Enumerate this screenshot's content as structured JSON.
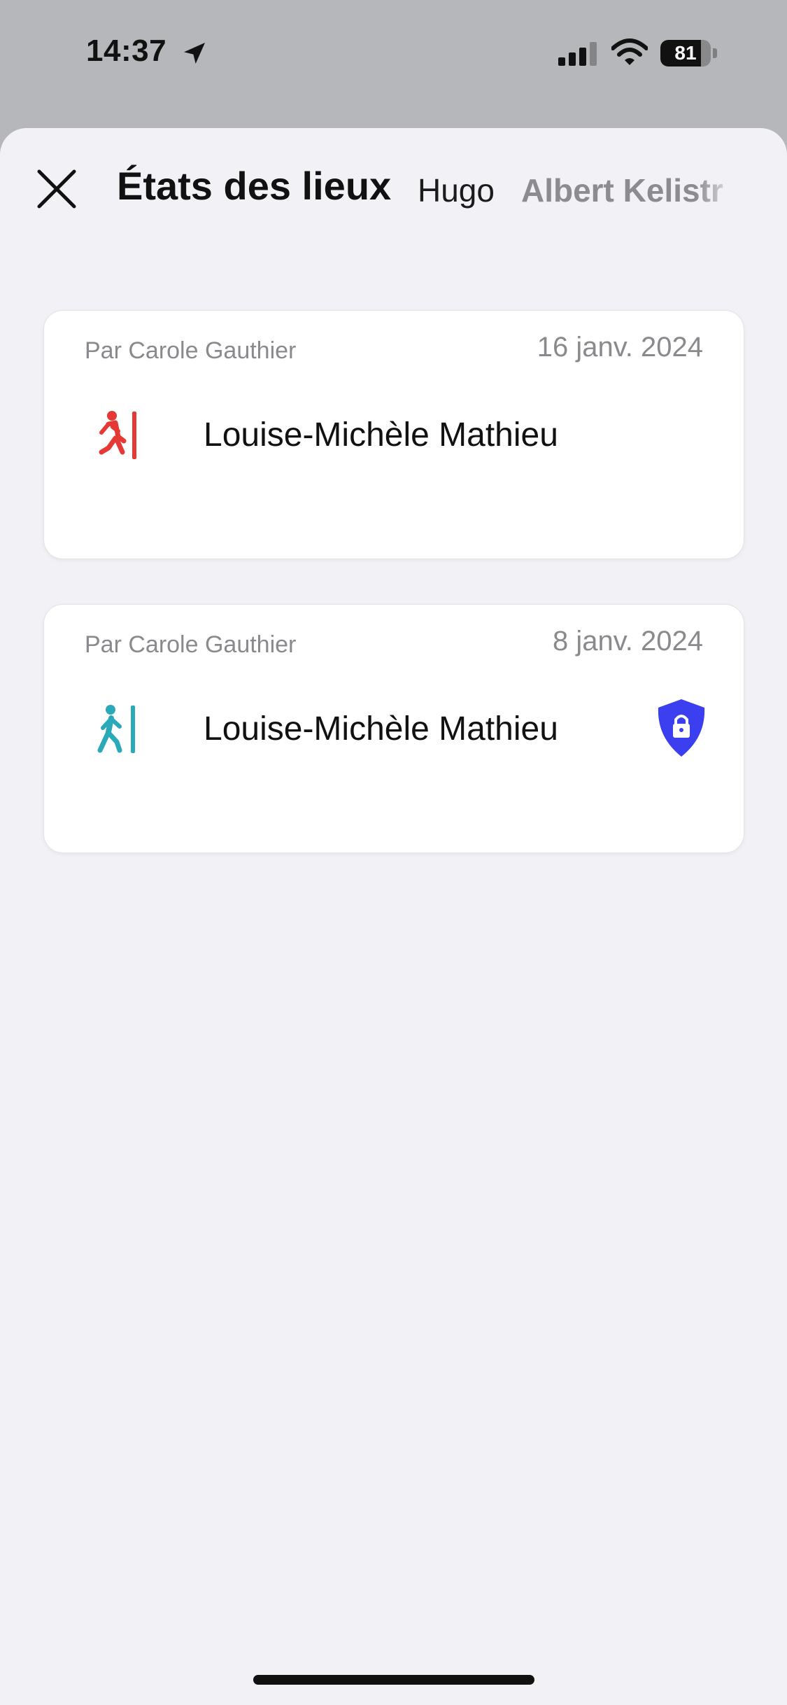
{
  "status_bar": {
    "time": "14:37",
    "battery_percent": "81",
    "battery_level": 0.81,
    "icons": [
      "location-arrow-icon",
      "cellular-signal-icon",
      "wifi-icon",
      "battery-icon"
    ]
  },
  "header": {
    "title": "États des lieux",
    "tabs": [
      {
        "label": "Hugo"
      },
      {
        "label": "Albert Kelistr"
      }
    ]
  },
  "cards": [
    {
      "author": "Par Carole Gauthier",
      "date": "16 janv. 2024",
      "name": "Louise-Michèle Mathieu",
      "type_icon": "walk-out-icon",
      "icon_color": "#e53935",
      "locked": false
    },
    {
      "author": "Par Carole Gauthier",
      "date": "8 janv. 2024",
      "name": "Louise-Michèle Mathieu",
      "type_icon": "walk-in-icon",
      "icon_color": "#2aa9b9",
      "locked": true,
      "lock_color": "#3b3ff0"
    }
  ]
}
